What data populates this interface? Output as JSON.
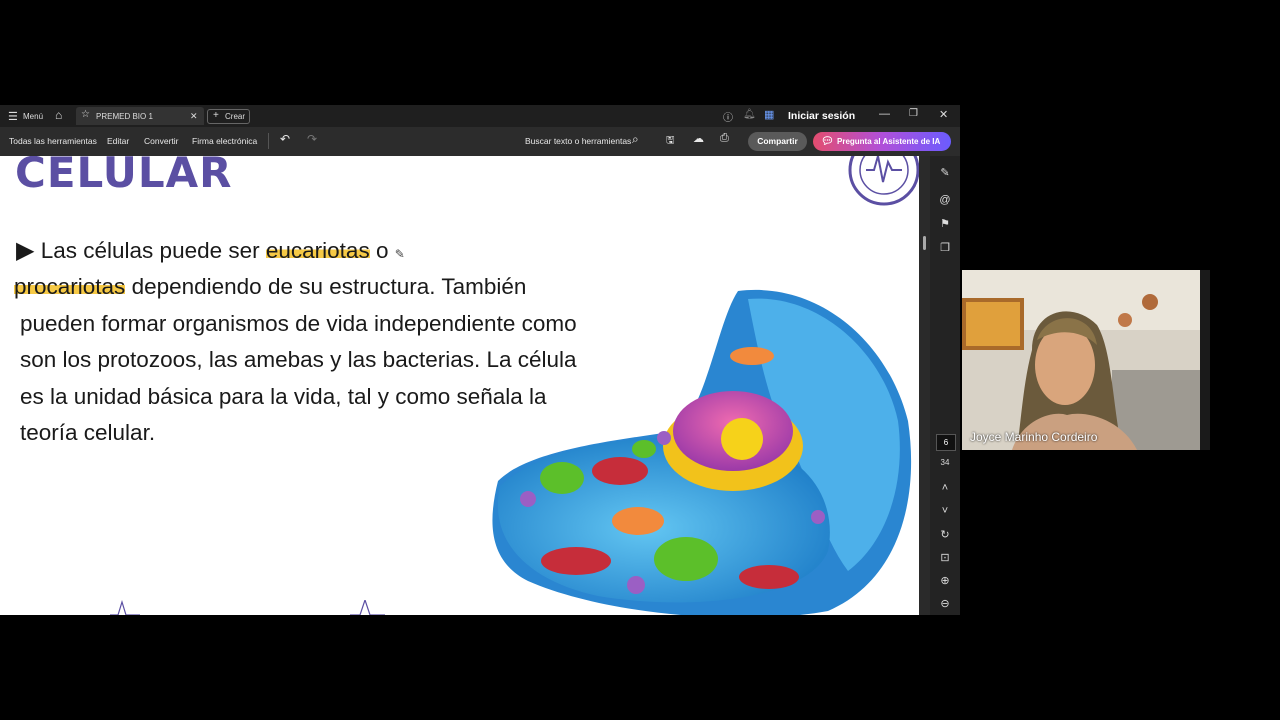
{
  "titlebar": {
    "menu_label": "Menú",
    "tab_label": "PREMED BIO 1",
    "create_label": "Crear",
    "signin_label": "Iniciar sesión"
  },
  "toolbar": {
    "items": [
      "Todas las herramientas",
      "Editar",
      "Convertir",
      "Firma electrónica"
    ],
    "search_label": "Buscar texto o herramientas",
    "share_label": "Compartir",
    "ai_label": "Pregunta al Asistente de IA"
  },
  "slide": {
    "title": "CELULAR",
    "lines": [
      {
        "parts": [
          "Las células puede ser ",
          "eucariotas",
          " o"
        ]
      },
      {
        "parts": [
          "procariotas",
          " dependiendo de su estructura. También"
        ]
      },
      {
        "text": "pueden formar organismos de vida independiente como"
      },
      {
        "text": "son los protozoos, las amebas y las bacterias. La célula"
      },
      {
        "text": "es la unidad básica para la vida, tal y como señala la"
      },
      {
        "text": "teoría celular."
      }
    ]
  },
  "page_nav": {
    "current": "6",
    "total": "34"
  },
  "webcam": {
    "participant_name": "Joyce Marinho Cordeiro"
  },
  "colors": {
    "title": "#5b4fa3",
    "highlight": "#f6c945",
    "ai_button_start": "#e34d6f",
    "ai_button_end": "#6b5cff"
  }
}
